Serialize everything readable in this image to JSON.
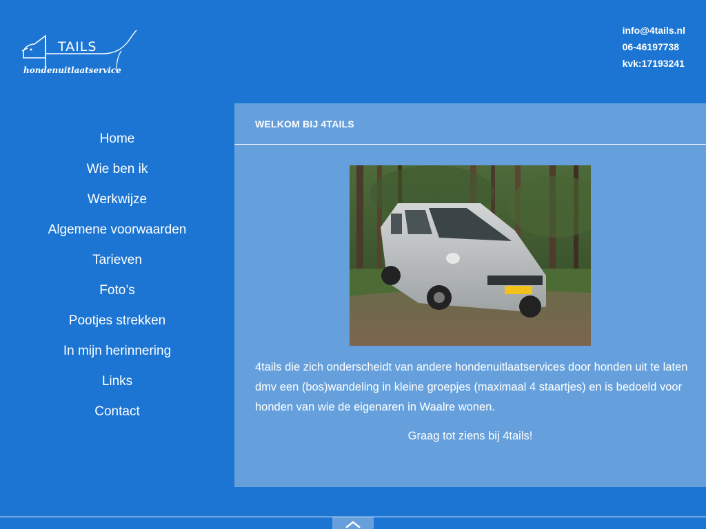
{
  "logo": {
    "number": "4",
    "name": "TAILS",
    "tagline": "hondenuitlaatservice"
  },
  "contact": {
    "email": "info@4tails.nl",
    "phone": "06-46197738",
    "kvk": "kvk:17193241"
  },
  "nav": {
    "items": [
      {
        "label": "Home"
      },
      {
        "label": "Wie ben ik"
      },
      {
        "label": "Werkwijze"
      },
      {
        "label": "Algemene voorwaarden"
      },
      {
        "label": "Tarieven"
      },
      {
        "label": "Foto’s"
      },
      {
        "label": "Pootjes strekken"
      },
      {
        "label": "In mijn herinnering"
      },
      {
        "label": "Links"
      },
      {
        "label": "Contact"
      }
    ]
  },
  "main": {
    "title": "WELKOM BIJ 4TAILS",
    "intro": "4tails die zich onderscheidt van andere hondenuitlaatservices door honden uit te laten dmv een (bos)wandeling in kleine  groepjes (maximaal 4 staartjes) en is bedoeld voor honden van wie de eigenaren in Waalre wonen.",
    "greeting": "Graag tot ziens bij 4tails!"
  },
  "colors": {
    "background": "#1c75d2",
    "content_panel": "#65a0dc",
    "text": "#ffffff"
  },
  "icons": {
    "scroll_top": "chevron-up-icon"
  }
}
